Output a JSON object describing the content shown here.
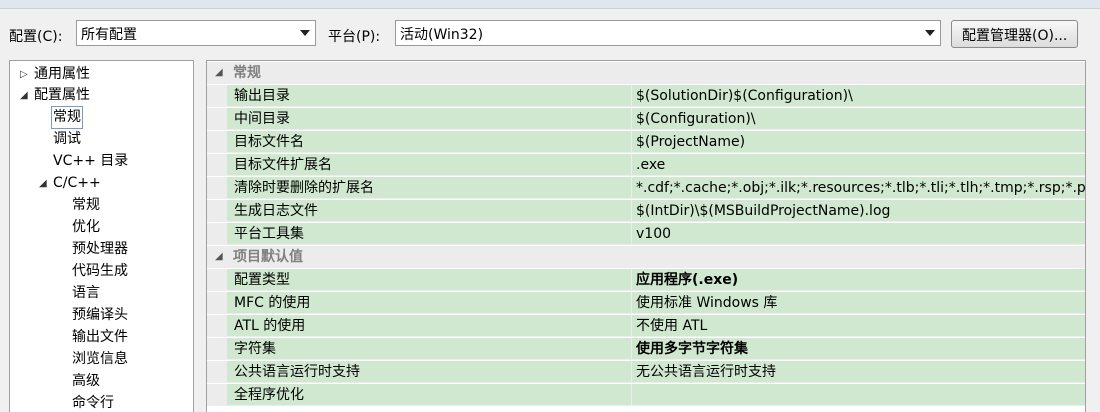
{
  "toolbar": {
    "config_label": "配置(C):",
    "config_value": "所有配置",
    "platform_label": "平台(P):",
    "platform_value": "活动(Win32)",
    "config_manager_button": "配置管理器(O)..."
  },
  "tree": {
    "items": [
      {
        "label": "通用属性",
        "expander": "▷"
      },
      {
        "label": "配置属性",
        "expander": "◢"
      },
      {
        "label": "常规",
        "selected": true
      },
      {
        "label": "调试"
      },
      {
        "label": "VC++ 目录"
      },
      {
        "label": "C/C++",
        "expander": "◢"
      },
      {
        "label": "常规"
      },
      {
        "label": "优化"
      },
      {
        "label": "预处理器"
      },
      {
        "label": "代码生成"
      },
      {
        "label": "语言"
      },
      {
        "label": "预编译头"
      },
      {
        "label": "输出文件"
      },
      {
        "label": "浏览信息"
      },
      {
        "label": "高级"
      },
      {
        "label": "命令行"
      }
    ]
  },
  "grid": {
    "categories": [
      {
        "label": "常规"
      },
      {
        "label": "项目默认值"
      }
    ],
    "general_rows": [
      {
        "name": "输出目录",
        "value": "$(SolutionDir)$(Configuration)\\"
      },
      {
        "name": "中间目录",
        "value": "$(Configuration)\\"
      },
      {
        "name": "目标文件名",
        "value": "$(ProjectName)"
      },
      {
        "name": "目标文件扩展名",
        "value": ".exe"
      },
      {
        "name": "清除时要删除的扩展名",
        "value": "*.cdf;*.cache;*.obj;*.ilk;*.resources;*.tlb;*.tli;*.tlh;*.tmp;*.rsp;*.p"
      },
      {
        "name": "生成日志文件",
        "value": "$(IntDir)\\$(MSBuildProjectName).log"
      },
      {
        "name": "平台工具集",
        "value": "v100"
      }
    ],
    "default_rows": [
      {
        "name": "配置类型",
        "value": "应用程序(.exe)",
        "bold": true
      },
      {
        "name": "MFC 的使用",
        "value": "使用标准 Windows 库"
      },
      {
        "name": "ATL 的使用",
        "value": "不使用 ATL"
      },
      {
        "name": "字符集",
        "value": "使用多字节字符集",
        "bold": true
      },
      {
        "name": "公共语言运行时支持",
        "value": "无公共语言运行时支持"
      },
      {
        "name": "全程序优化",
        "value": ""
      }
    ]
  },
  "colors": {
    "row_bg": "#cfe8cf",
    "category_bg": "#ececec",
    "selection_border": "#7a9cc0"
  }
}
